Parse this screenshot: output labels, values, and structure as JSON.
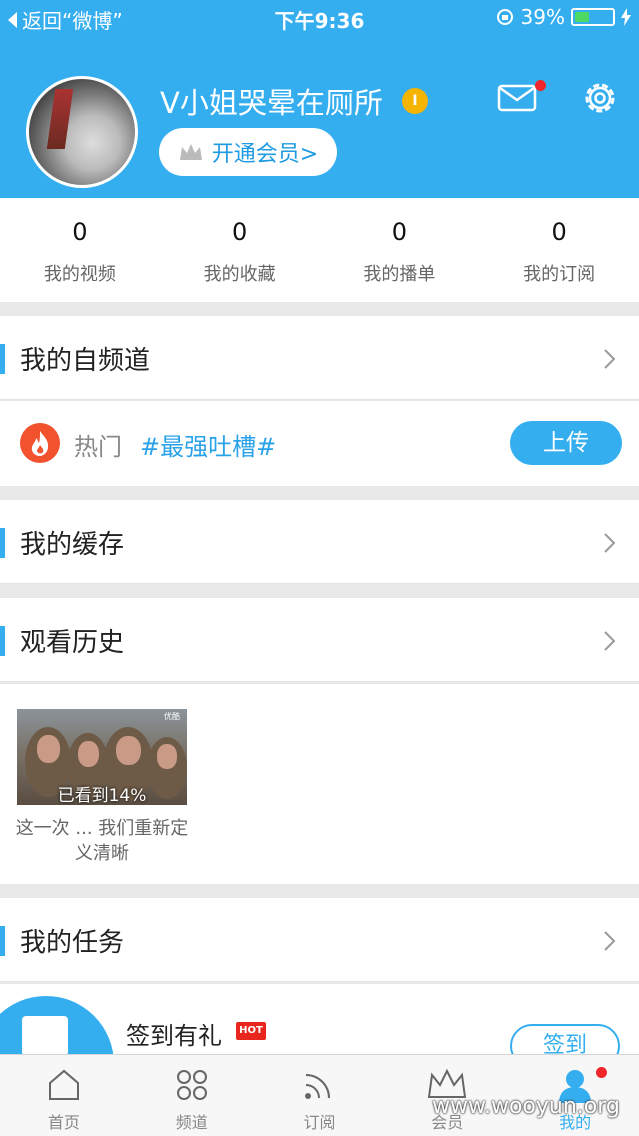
{
  "status_bar": {
    "back_label": "返回“微博”",
    "time": "下午9:36",
    "battery_percent": "39%",
    "battery_level": 0.39
  },
  "profile": {
    "username": "V小姐哭晕在厕所",
    "vip_badge": "I",
    "member_button": "开通会员>"
  },
  "stats": [
    {
      "value": "0",
      "label": "我的视频"
    },
    {
      "value": "0",
      "label": "我的收藏"
    },
    {
      "value": "0",
      "label": "我的播单"
    },
    {
      "value": "0",
      "label": "我的订阅"
    }
  ],
  "sections": {
    "channel": "我的自频道",
    "cache": "我的缓存",
    "history": "观看历史",
    "tasks": "我的任务"
  },
  "hot": {
    "label": "热门",
    "topic": "#最强吐槽#",
    "upload_button": "上传"
  },
  "history": {
    "progress": "已看到14%",
    "title": "这一次 ... 我们重新定义清晰",
    "tag": "优酷"
  },
  "task": {
    "title": "签到有礼",
    "badge": "HOT",
    "button": "签到"
  },
  "tabs": [
    {
      "label": "首页",
      "icon": "home-icon"
    },
    {
      "label": "频道",
      "icon": "grid-icon"
    },
    {
      "label": "订阅",
      "icon": "rss-icon"
    },
    {
      "label": "会员",
      "icon": "crown-icon"
    },
    {
      "label": "我的",
      "icon": "person-icon",
      "active": true
    }
  ],
  "watermark": "www.wooyun.org",
  "colors": {
    "accent": "#35aef0",
    "alert": "#f0262b",
    "vip": "#f5b400"
  }
}
